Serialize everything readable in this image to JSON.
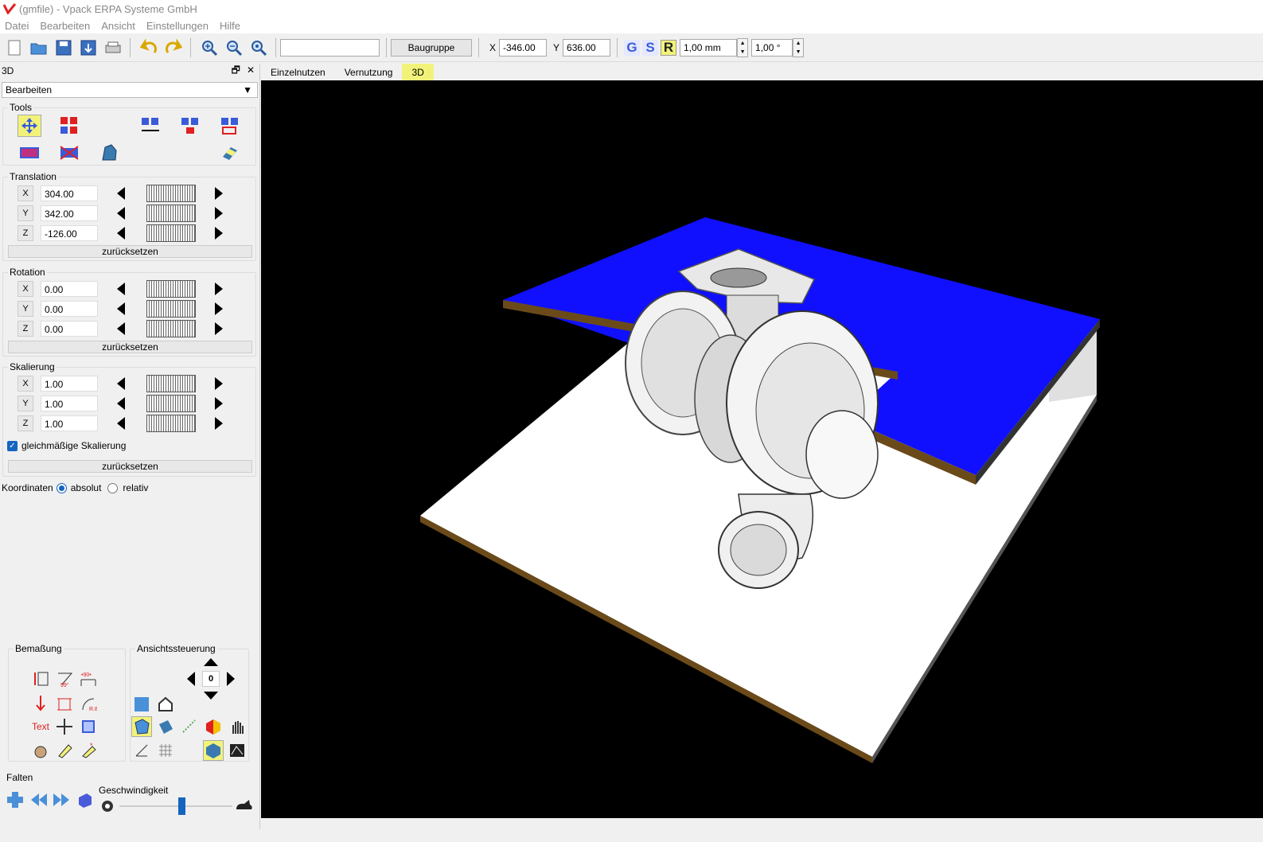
{
  "window": {
    "title": "(gmfile) - Vpack ERPA Systeme GmbH"
  },
  "menu": [
    "Datei",
    "Bearbeiten",
    "Ansicht",
    "Einstellungen",
    "Hilfe"
  ],
  "toolbar": {
    "search_value": "",
    "group_button": "Baugruppe",
    "x_label": "X",
    "x_value": "-346.00",
    "y_label": "Y",
    "y_value": "636.00",
    "g_label": "G",
    "s_label": "S",
    "r_label": "R",
    "step_value": "1,00 mm",
    "angle_value": "1,00 °"
  },
  "panel": {
    "title": "3D",
    "mode": "Bearbeiten",
    "tools_title": "Tools",
    "translation": {
      "title": "Translation",
      "x_label": "X",
      "x": "304.00",
      "y_label": "Y",
      "y": "342.00",
      "z_label": "Z",
      "z": "-126.00",
      "reset": "zurücksetzen"
    },
    "rotation": {
      "title": "Rotation",
      "x_label": "X",
      "x": "0.00",
      "y_label": "Y",
      "y": "0.00",
      "z_label": "Z",
      "z": "0.00",
      "reset": "zurücksetzen"
    },
    "scaling": {
      "title": "Skalierung",
      "x_label": "X",
      "x": "1.00",
      "y_label": "Y",
      "y": "1.00",
      "z_label": "Z",
      "z": "1.00",
      "uniform_label": "gleichmäßige Skalierung",
      "uniform_checked": true,
      "reset": "zurücksetzen"
    },
    "coords": {
      "label": "Koordinaten",
      "absolute": "absolut",
      "relative": "relativ",
      "selected": "absolut"
    },
    "dimension_title": "Bemaßung",
    "dim_text_label": "Text",
    "view_title": "Ansichtssteuerung",
    "view_center": "0",
    "fold_title": "Falten",
    "speed_label": "Geschwindigkeit",
    "speed_level": 0.55
  },
  "tabs": [
    "Einzelnutzen",
    "Vernutzung",
    "3D"
  ],
  "active_tab": "3D",
  "colors": {
    "accent_yellow": "#f2f27a",
    "board_blue": "#1010ff",
    "board_white": "#ffffff",
    "edge_brown": "#6b4a1a",
    "viewport_bg": "#000000",
    "icon_blue": "#3a5bd9",
    "icon_red": "#e02020"
  }
}
